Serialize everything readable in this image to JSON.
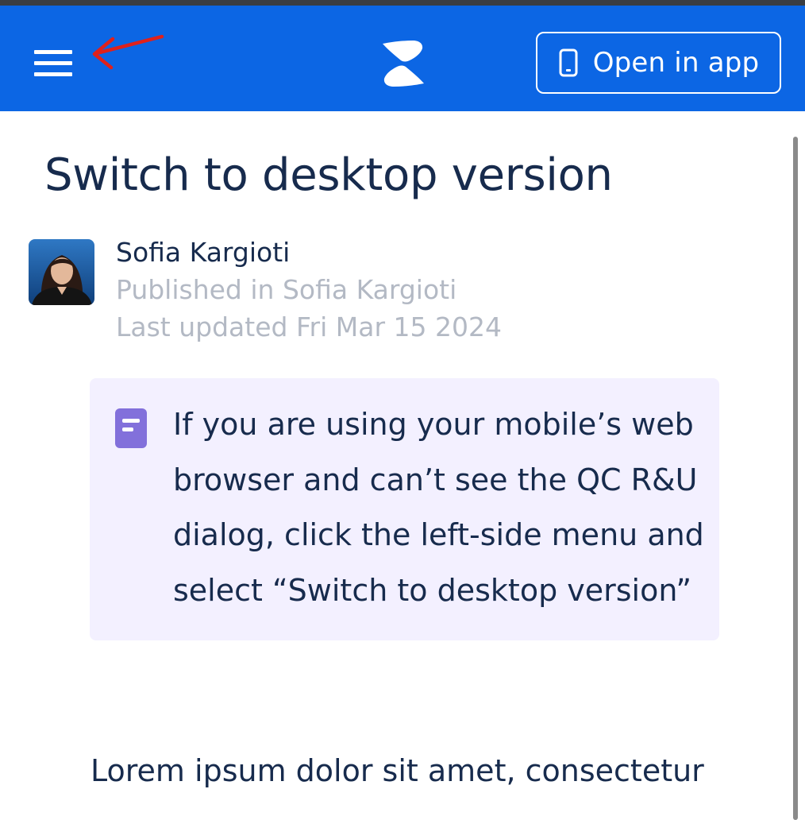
{
  "header": {
    "menu_icon": "hamburger-menu-icon",
    "annotation_icon": "red-arrow-annotation",
    "logo_icon": "confluence-logo-icon",
    "open_in_app_label": "Open in app",
    "open_in_app_icon": "mobile-phone-icon",
    "background_color": "#0c66e4"
  },
  "page": {
    "title": "Switch to desktop version",
    "author": {
      "name": "Sofia Kargioti",
      "avatar_icon": "user-avatar"
    },
    "published_in": "Published in Sofia Kargioti",
    "last_updated": "Last updated Fri Mar 15 2024"
  },
  "note_panel": {
    "icon": "note-icon",
    "text": "If you are using your mobile’s web browser and can’t see the QC R&U dialog, click the left-side menu and select “Switch to desktop version”",
    "background_color": "#f3f0ff",
    "icon_color": "#8270db"
  },
  "body": {
    "paragraph_start": "Lorem ipsum dolor sit amet, consectetur"
  }
}
